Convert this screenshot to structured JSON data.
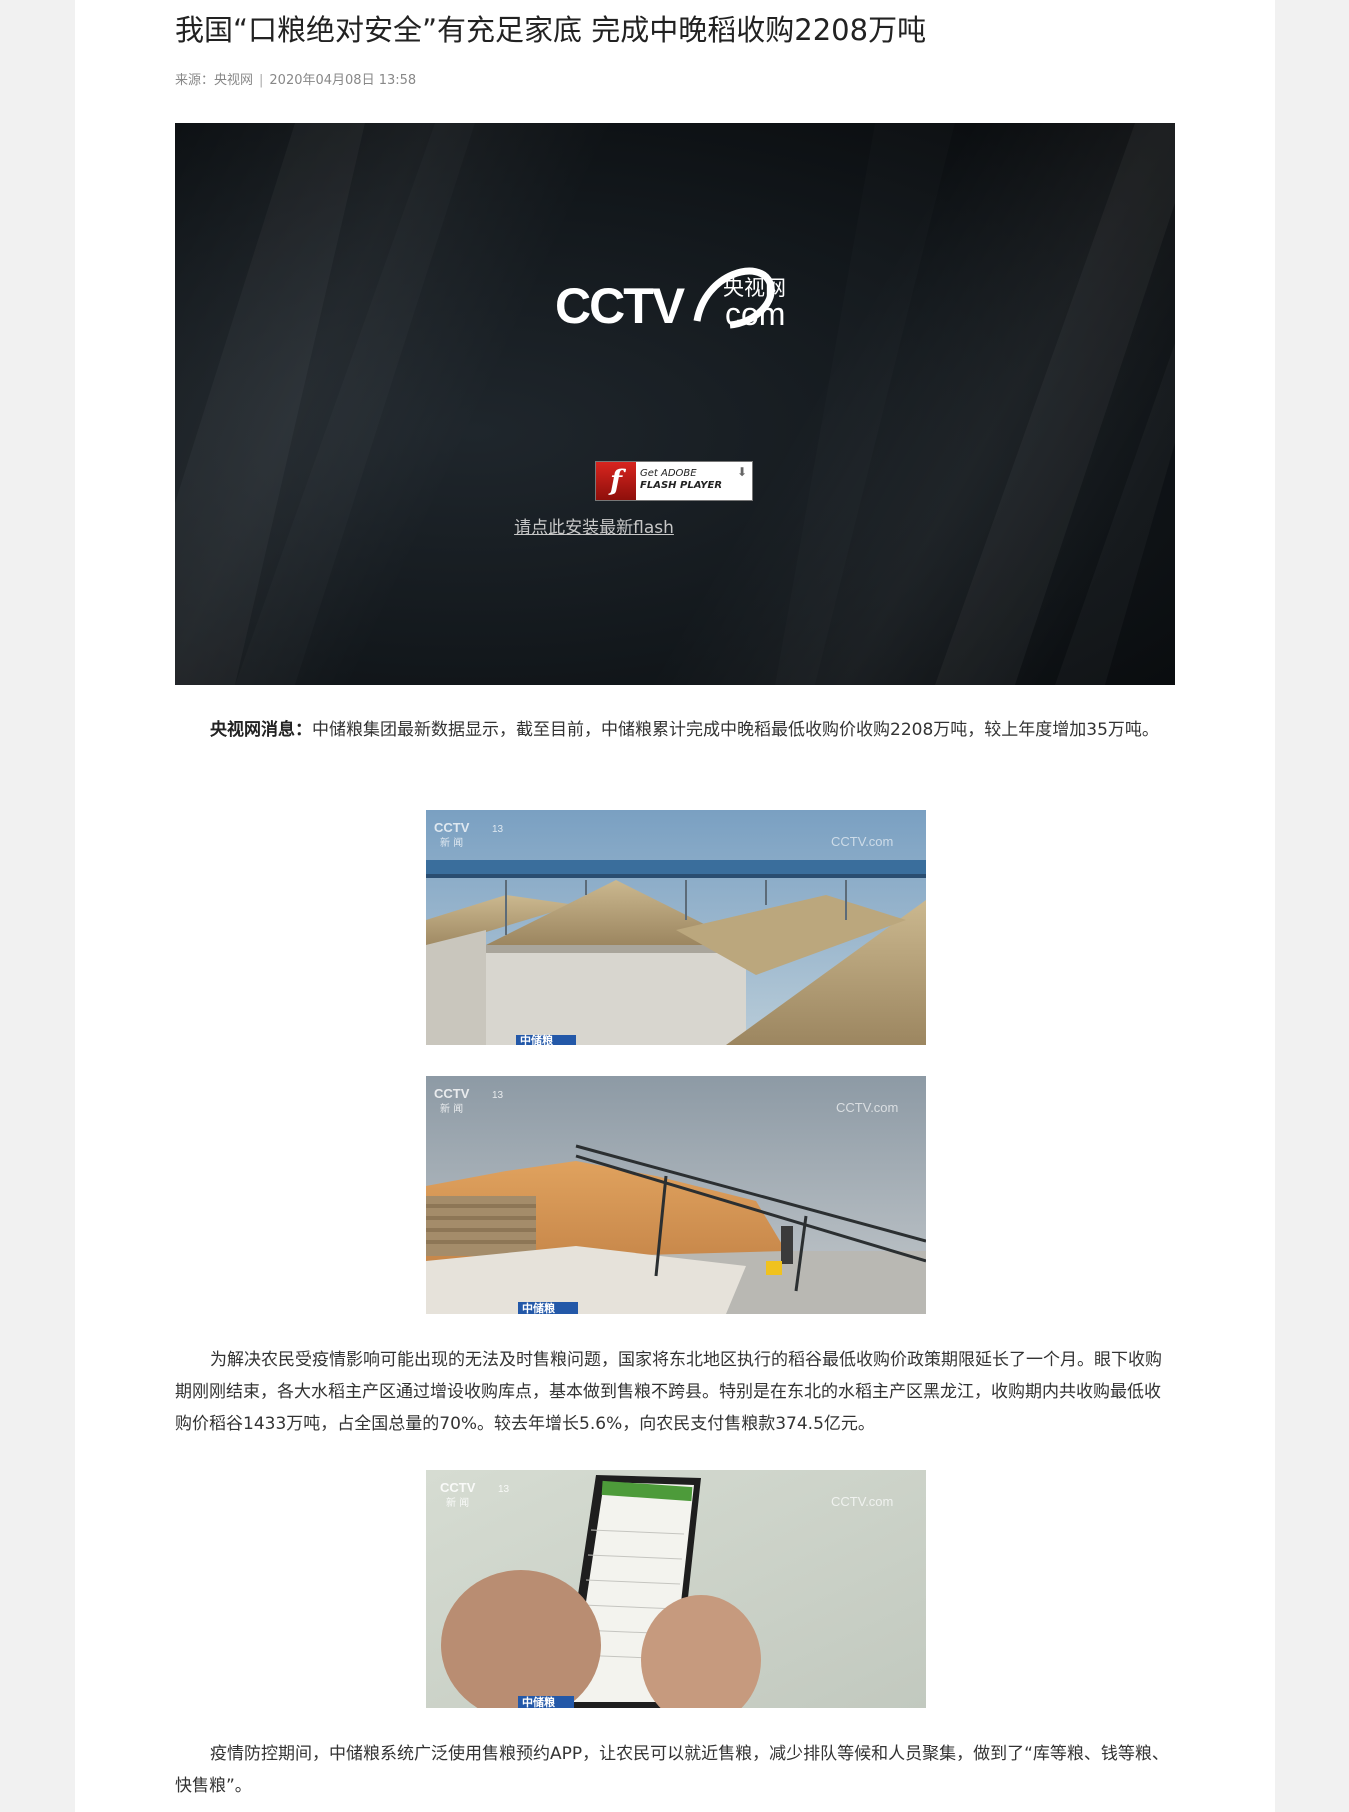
{
  "article": {
    "title": "我国“口粮绝对安全”有充足家底 完成中晚稻收购2208万吨",
    "source": "来源：央视网",
    "separator": "|",
    "datetime": "2020年04月08日 13:58"
  },
  "video": {
    "logo_text": "CCTV",
    "logo_cn": "央视网",
    "logo_com": "com",
    "flash_get": "Get ADOBE",
    "flash_player": "FLASH PLAYER",
    "flash_link": "请点此安装最新flash"
  },
  "body": {
    "p1_lead": "央视网消息：",
    "p1_text": "中储粮集团最新数据显示，截至目前，中储粮累计完成中晚稻最低收购价收购2208万吨，较上年度增加35万吨。",
    "p2_text": "为解决农民受疫情影响可能出现的无法及时售粮问题，国家将东北地区执行的稻谷最低收购价政策期限延长了一个月。眼下收购期刚刚结束，各大水稻主产区通过增设收购库点，基本做到售粮不跨县。特别是在东北的水稻主产区黑龙江，收购期内共收购最低收购价稻谷1433万吨，占全国总量的70%。较去年增长5.6%，向农民支付售粮款374.5亿元。",
    "p3_text": "疫情防控期间，中储粮系统广泛使用售粮预约APP，让农民可以就近售粮，减少排队等候和人员聚集，做到了“库等粮、钱等粮、快售粮”。"
  },
  "images": {
    "channel_logo": "CCTV",
    "channel_num": "13",
    "channel_sub": "新 闻",
    "watermark": "CCTV.com",
    "caption": "中储粮"
  }
}
